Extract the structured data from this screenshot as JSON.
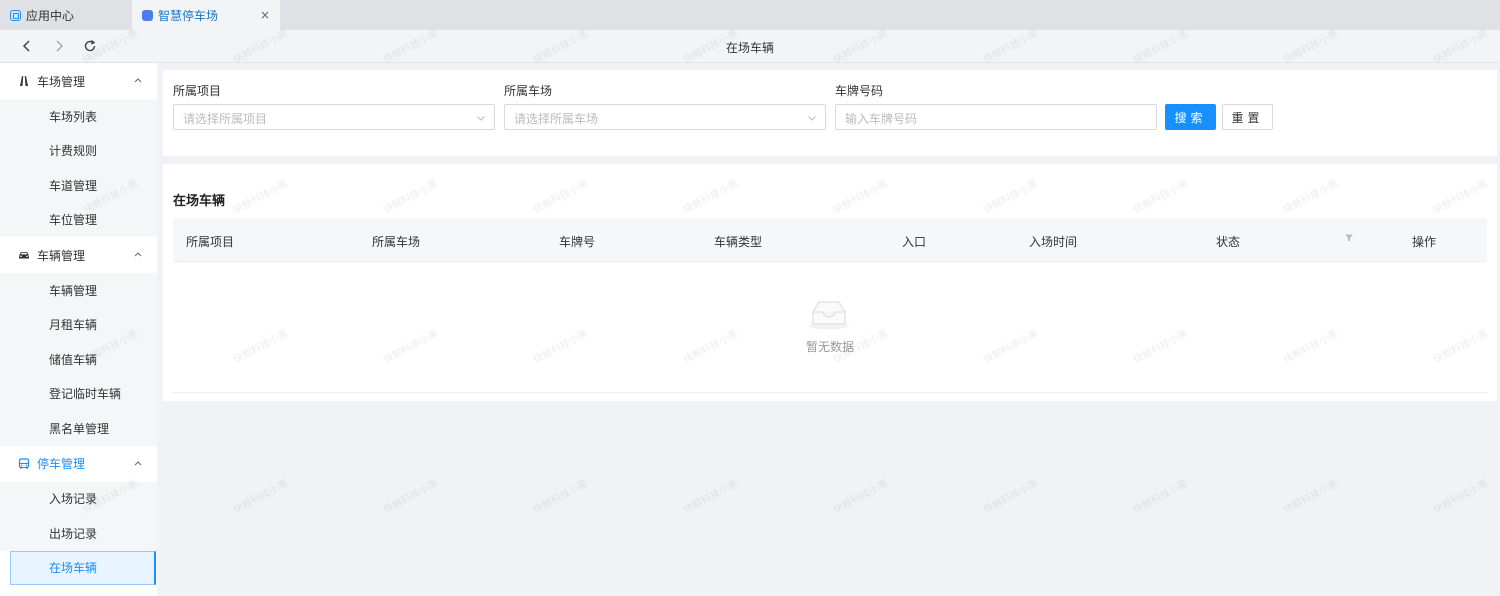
{
  "tabs": [
    {
      "label": "应用中心",
      "icon": "app-center-icon",
      "active": false
    },
    {
      "label": "智慧停车场",
      "icon": "parking-app-icon",
      "active": true,
      "close": "×"
    }
  ],
  "nav": {
    "title": "在场车辆"
  },
  "sidebar": {
    "groups": [
      {
        "label": "车场管理",
        "icon": "parking-lot-icon",
        "items": [
          "车场列表",
          "计费规则",
          "车道管理",
          "车位管理"
        ]
      },
      {
        "label": "车辆管理",
        "icon": "car-icon",
        "items": [
          "车辆管理",
          "月租车辆",
          "储值车辆",
          "登记临时车辆",
          "黑名单管理"
        ]
      },
      {
        "label": "停车管理",
        "icon": "bus-icon",
        "items": [
          "入场记录",
          "出场记录",
          "在场车辆"
        ]
      }
    ],
    "selected": "在场车辆"
  },
  "filters": {
    "project_label": "所属项目",
    "project_placeholder": "请选择所属项目",
    "lot_label": "所属车场",
    "lot_placeholder": "请选择所属车场",
    "plate_label": "车牌号码",
    "plate_placeholder": "输入车牌号码",
    "search_label": "搜索",
    "reset_label": "重置"
  },
  "table": {
    "title": "在场车辆",
    "columns": [
      "所属项目",
      "所属车场",
      "车牌号",
      "车辆类型",
      "入口",
      "入场时间",
      "状态",
      "操作"
    ],
    "empty_text": "暂无数据"
  },
  "watermark": "快鲸科技小黑",
  "colors": {
    "primary": "#1890ff",
    "bg": "#f0f2f5"
  }
}
